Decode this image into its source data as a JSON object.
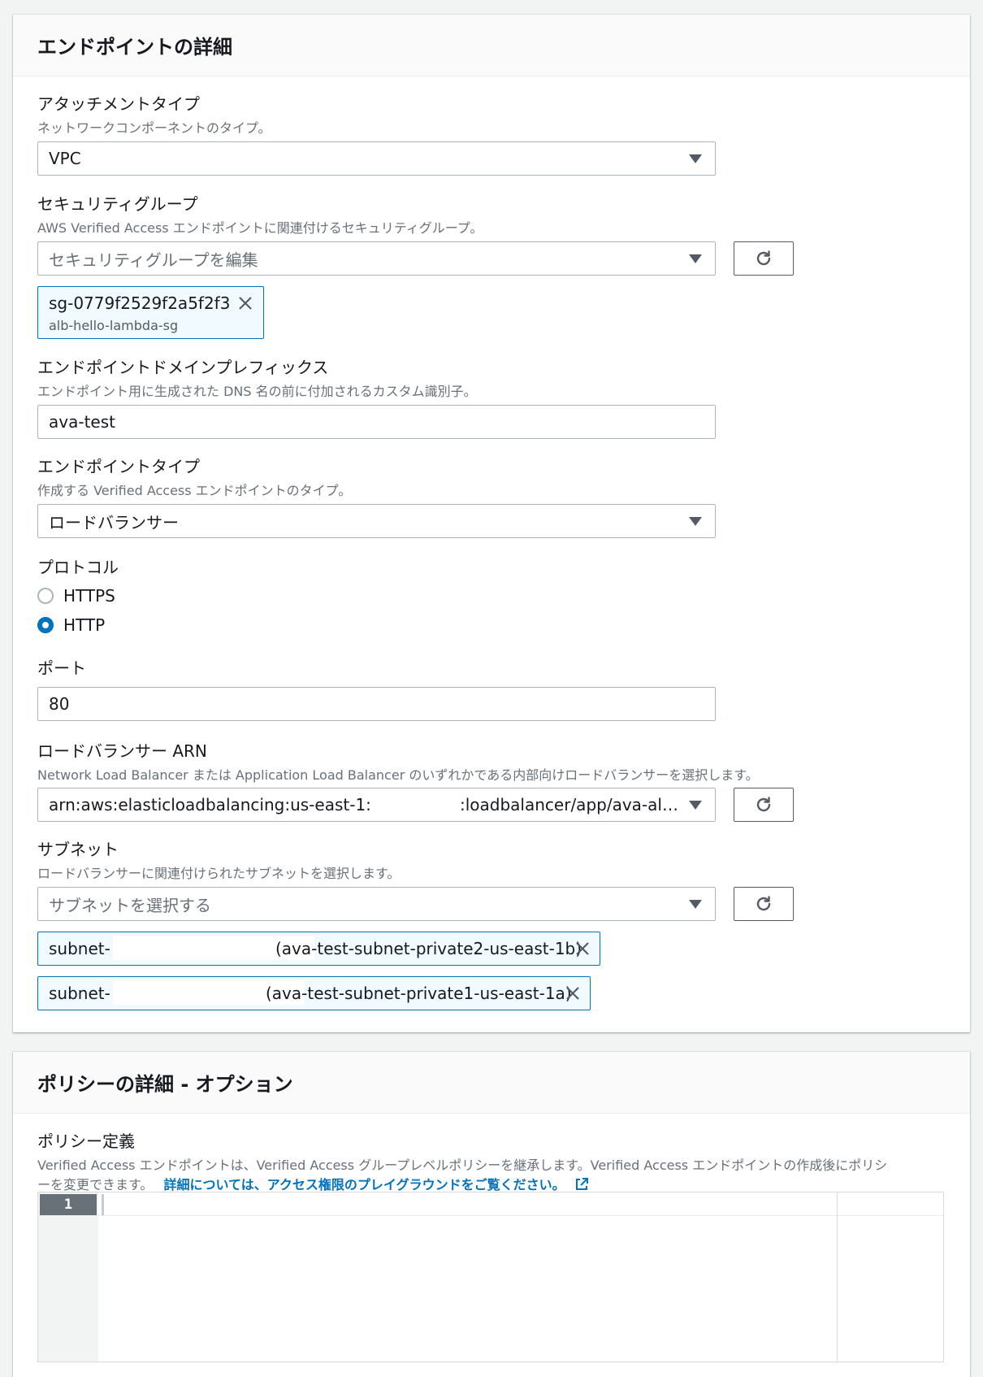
{
  "endpoint_panel": {
    "title": "エンドポイントの詳細",
    "attachment": {
      "label": "アタッチメントタイプ",
      "description": "ネットワークコンポーネントのタイプ。",
      "value": "VPC"
    },
    "security_group": {
      "label": "セキュリティグループ",
      "description": "AWS Verified Access エンドポイントに関連付けるセキュリティグループ。",
      "placeholder": "セキュリティグループを編集",
      "token": {
        "id": "sg-0779f2529f2a5f2f3",
        "name": "alb-hello-lambda-sg"
      }
    },
    "domain_prefix": {
      "label": "エンドポイントドメインプレフィックス",
      "description": "エンドポイント用に生成された DNS 名の前に付加されるカスタム識別子。",
      "value": "ava-test"
    },
    "endpoint_type": {
      "label": "エンドポイントタイプ",
      "description": "作成する Verified Access エンドポイントのタイプ。",
      "value": "ロードバランサー"
    },
    "protocol": {
      "label": "プロトコル",
      "options": [
        "HTTPS",
        "HTTP"
      ],
      "selected": "HTTP"
    },
    "port": {
      "label": "ポート",
      "value": "80"
    },
    "lb_arn": {
      "label": "ロードバランサー ARN",
      "description": "Network Load Balancer または Application Load Balancer のいずれかである内部向けロードバランサーを選択します。",
      "value_start": "arn:aws:elasticloadbalancing:us-east-1:",
      "value_end": ":loadbalancer/app/ava-al…"
    },
    "subnet": {
      "label": "サブネット",
      "description": "ロードバランサーに関連付けられたサブネットを選択します。",
      "placeholder": "サブネットを選択する",
      "tokens": [
        {
          "prefix": "subnet-",
          "name": "(ava-test-subnet-private2-us-east-1b)"
        },
        {
          "prefix": "subnet-",
          "name": "(ava-test-subnet-private1-us-east-1a)"
        }
      ]
    }
  },
  "policy_panel": {
    "title": "ポリシーの詳細 - オプション",
    "label": "ポリシー定義",
    "description_line1": "Verified Access エンドポイントは、Verified Access グループレベルポリシーを継承します。Verified Access エンドポイントの作成後にポリシ",
    "description_line2": "ーを変更できます。",
    "link_text": "詳細については、アクセス権限のプレイグラウンドをご覧ください。",
    "editor": {
      "line_number": "1"
    }
  },
  "colors": {
    "accent": "#0073bb",
    "token_bg": "#f1faff"
  }
}
